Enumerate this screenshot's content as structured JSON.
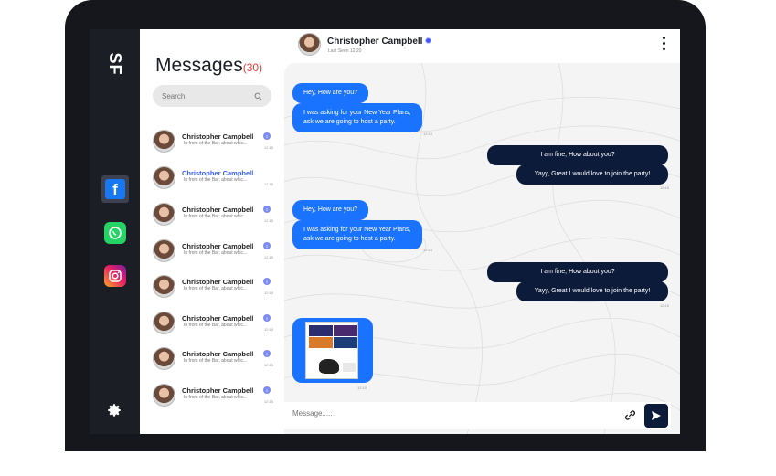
{
  "brand": "SF",
  "sidebar": {
    "apps": [
      {
        "name": "facebook-icon",
        "glyph": "f"
      },
      {
        "name": "whatsapp-icon"
      },
      {
        "name": "instagram-icon"
      }
    ],
    "settings_icon": "gear-icon"
  },
  "messages_panel": {
    "title": "Messages",
    "count": "(30)",
    "search_placeholder": "Search",
    "conversations": [
      {
        "name": "Christopher Campbell",
        "preview": "In front of the Bar, about whic...",
        "time": "12:15",
        "badge": "2",
        "active": false
      },
      {
        "name": "Christopher Campbell",
        "preview": "In front of the Bar, about whic...",
        "time": "12:15",
        "badge": "",
        "active": true
      },
      {
        "name": "Christopher Campbell",
        "preview": "In front of the Bar, about whic...",
        "time": "12:15",
        "badge": "2",
        "active": false
      },
      {
        "name": "Christopher Campbell",
        "preview": "In front of the Bar, about whic...",
        "time": "12:15",
        "badge": "2",
        "active": false
      },
      {
        "name": "Christopher Campbell",
        "preview": "In front of the Bar, about whic...",
        "time": "12:15",
        "badge": "2",
        "active": false
      },
      {
        "name": "Christopher Campbell",
        "preview": "In front of the Bar, about whic...",
        "time": "12:15",
        "badge": "2",
        "active": false
      },
      {
        "name": "Christopher Campbell",
        "preview": "In front of the Bar, about whic...",
        "time": "12:15",
        "badge": "2",
        "active": false
      },
      {
        "name": "Christopher Campbell",
        "preview": "In front of the Bar, about whic...",
        "time": "12:15",
        "badge": "2",
        "active": false
      }
    ]
  },
  "chat": {
    "contact_name": "Christopher Campbell",
    "last_seen": "Last Seen 12:20",
    "messages": [
      {
        "dir": "in",
        "lines": [
          "Hey, How are you?"
        ]
      },
      {
        "dir": "in",
        "lines": [
          "I was asking for your New Year Plans,",
          "ask we are going to host a party."
        ]
      },
      {
        "dir": "in-time",
        "lines": [
          "12:15"
        ]
      },
      {
        "dir": "out",
        "lines": [
          "I am fine, How about you?"
        ]
      },
      {
        "dir": "out",
        "lines": [
          "Yayy, Great I would love to join the party!"
        ]
      },
      {
        "dir": "out-time",
        "lines": [
          "12:15"
        ]
      },
      {
        "dir": "in",
        "lines": [
          "Hey, How are you?"
        ]
      },
      {
        "dir": "in",
        "lines": [
          "I was asking for your New Year Plans,",
          "ask we are going to host a party."
        ]
      },
      {
        "dir": "in-time",
        "lines": [
          "12:15"
        ]
      },
      {
        "dir": "out",
        "lines": [
          "I am fine, How about you?"
        ]
      },
      {
        "dir": "out",
        "lines": [
          "Yayy, Great I would love to join the party!"
        ]
      },
      {
        "dir": "out-time",
        "lines": [
          "12:15"
        ]
      },
      {
        "dir": "image",
        "lines": [
          "12:15"
        ]
      }
    ],
    "composer_placeholder": "Message.....",
    "attach_icon": "link-icon",
    "send_icon": "send-icon"
  },
  "colors": {
    "incoming": "#1a73ff",
    "outgoing": "#0c1b3a",
    "accent": "#3d5afe",
    "count": "#e53935"
  }
}
